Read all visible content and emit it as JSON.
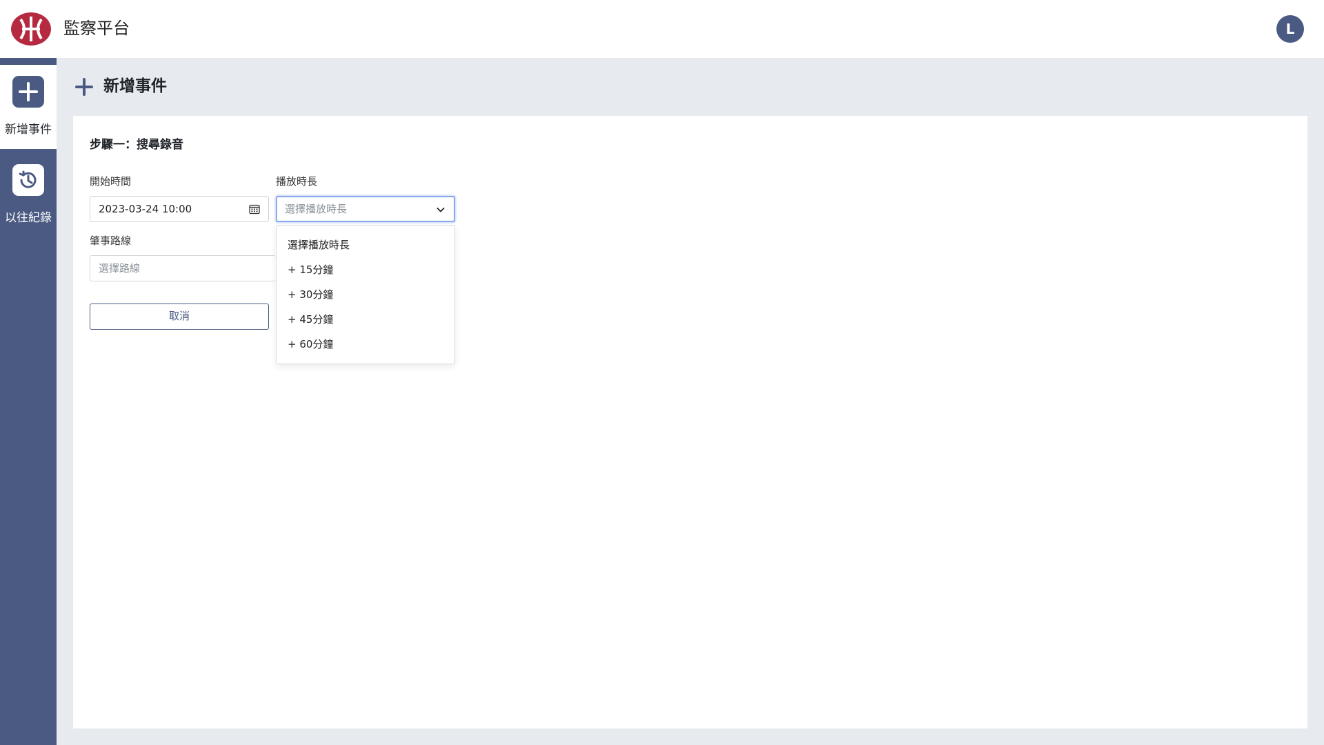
{
  "header": {
    "app_title": "監察平台",
    "avatar_initial": "L",
    "brand_color": "#b52a40",
    "accent_color": "#4a5a82"
  },
  "sidebar": {
    "items": [
      {
        "label": "新增事件",
        "icon": "plus-icon",
        "active": true
      },
      {
        "label": "以往紀錄",
        "icon": "history-icon",
        "active": false
      }
    ]
  },
  "page": {
    "title": "新增事件",
    "step_title": "步驟一：搜尋錄音"
  },
  "form": {
    "start_time": {
      "label": "開始時間",
      "value": "2023-03-24  10:00"
    },
    "duration": {
      "label": "播放時長",
      "placeholder": "選擇播放時長",
      "options": [
        "選擇播放時長",
        "+ 15分鐘",
        "+ 30分鐘",
        "+ 45分鐘",
        "+ 60分鐘"
      ]
    },
    "route": {
      "label": "肇事路線",
      "placeholder": "選擇路線"
    },
    "cancel_label": "取消"
  }
}
